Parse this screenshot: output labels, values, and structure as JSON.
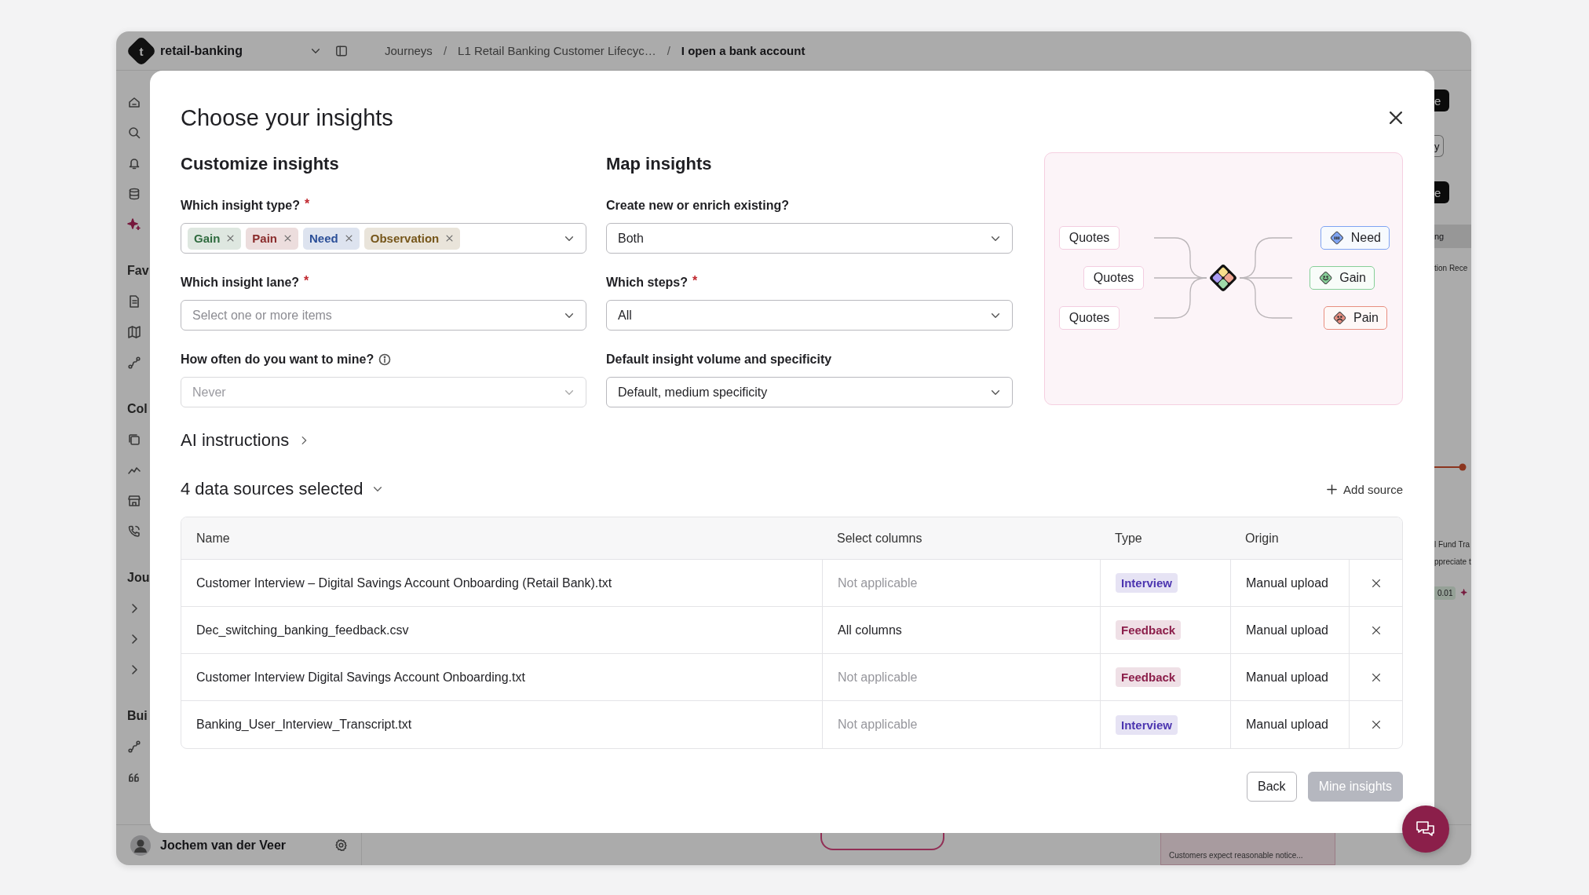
{
  "app": {
    "logo_letter": "t",
    "workspace": "retail-banking",
    "breadcrumb_separator": "/",
    "breadcrumbs": [
      {
        "label": "Journeys",
        "current": false
      },
      {
        "label": "L1 Retail Banking Customer Lifecyc…",
        "current": false
      },
      {
        "label": "I open a bank account",
        "current": true
      }
    ],
    "sidebar_sections": [
      {
        "label": "Fav"
      },
      {
        "label": "Col"
      },
      {
        "label": "Jou"
      },
      {
        "label": "Bui"
      }
    ],
    "user": {
      "name": "Jochem van der Veer"
    },
    "side_fragments": [
      {
        "kind": "dark-button",
        "text": "e"
      },
      {
        "kind": "outline-button",
        "text": "y"
      },
      {
        "kind": "dark-button",
        "text": "e"
      },
      {
        "kind": "band",
        "text": "ng"
      },
      {
        "kind": "label",
        "text": "tion Rece"
      },
      {
        "kind": "line"
      },
      {
        "kind": "label",
        "text": "l Fund Tra"
      },
      {
        "kind": "label",
        "text": "ppreciate t"
      },
      {
        "kind": "chip",
        "text": "0.01"
      }
    ],
    "bottom_note": "Customers expect reasonable notice..."
  },
  "modal": {
    "title": "Choose your insights",
    "required_mark": "*",
    "sections": [
      {
        "heading": "Customize insights",
        "fields": [
          {
            "kind": "tags",
            "label": "Which insight type?",
            "required": true,
            "info": false,
            "disabled": false,
            "tags": [
              {
                "label": "Gain",
                "color": "#2f6b3f"
              },
              {
                "label": "Pain",
                "color": "#8a2c2c"
              },
              {
                "label": "Need",
                "color": "#2b4f98"
              },
              {
                "label": "Observation",
                "color": "#76561a"
              }
            ]
          },
          {
            "kind": "select",
            "label": "Which insight lane?",
            "required": true,
            "info": false,
            "disabled": false,
            "placeholder": "Select one or more items"
          },
          {
            "kind": "select",
            "label": "How often do you want to mine?",
            "required": false,
            "info": true,
            "disabled": true,
            "value": "Never"
          }
        ]
      },
      {
        "heading": "Map insights",
        "fields": [
          {
            "kind": "select",
            "label": "Create new or enrich existing?",
            "required": false,
            "info": false,
            "disabled": false,
            "value": "Both"
          },
          {
            "kind": "select",
            "label": "Which steps?",
            "required": true,
            "info": false,
            "disabled": false,
            "value": "All"
          },
          {
            "kind": "select",
            "label": "Default insight volume and specificity",
            "required": false,
            "info": false,
            "disabled": false,
            "value": "Default, medium specificity"
          }
        ]
      }
    ],
    "diagram": {
      "sources": [
        "Quotes",
        "Quotes",
        "Quotes"
      ],
      "outputs": [
        {
          "label": "Need",
          "color": "#7ea4f2"
        },
        {
          "label": "Gain",
          "color": "#86cf98"
        },
        {
          "label": "Pain",
          "color": "#e88e80"
        }
      ]
    },
    "ai_instructions": "AI instructions",
    "data_sources": {
      "title": "4 data sources selected",
      "add_label": "Add source",
      "columns": [
        "Name",
        "Select columns",
        "Type",
        "Origin"
      ],
      "rows": [
        {
          "name": "Customer Interview – Digital Savings Account Onboarding (Retail Bank).txt",
          "columns": "Not applicable",
          "muted": true,
          "type": {
            "label": "Interview",
            "color": "#4c35b0"
          },
          "origin": "Manual upload"
        },
        {
          "name": "Dec_switching_banking_feedback.csv",
          "columns": "All columns",
          "muted": false,
          "type": {
            "label": "Feedback",
            "color": "#8c1f4b"
          },
          "origin": "Manual upload"
        },
        {
          "name": "Customer Interview Digital Savings Account Onboarding.txt",
          "columns": "Not applicable",
          "muted": true,
          "type": {
            "label": "Feedback",
            "color": "#8c1f4b"
          },
          "origin": "Manual upload"
        },
        {
          "name": "Banking_User_Interview_Transcript.txt",
          "columns": "Not applicable",
          "muted": true,
          "type": {
            "label": "Interview",
            "color": "#4c35b0"
          },
          "origin": "Manual upload"
        }
      ]
    },
    "buttons": [
      {
        "label": "Back",
        "disabled": false
      },
      {
        "label": "Mine insights",
        "disabled": true
      }
    ]
  }
}
